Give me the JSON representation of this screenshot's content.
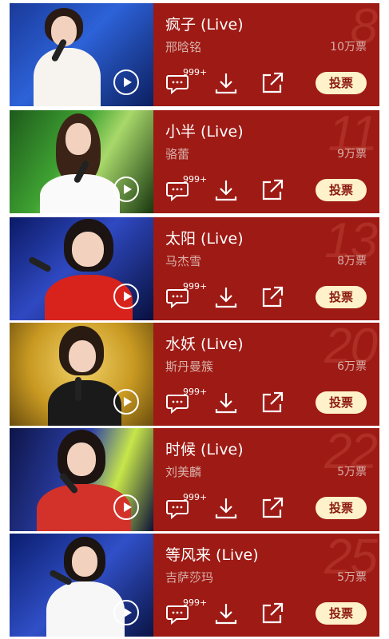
{
  "songs": [
    {
      "title": "疯子 (Live)",
      "artist": "邢晗铭",
      "votes": "10万票",
      "rank": "8",
      "comment_badge": "999+",
      "vote_label": "投票"
    },
    {
      "title": "小半 (Live)",
      "artist": "骆蕾",
      "votes": "9万票",
      "rank": "11",
      "comment_badge": "999+",
      "vote_label": "投票"
    },
    {
      "title": "太阳 (Live)",
      "artist": "马杰雪",
      "votes": "8万票",
      "rank": "13",
      "comment_badge": "999+",
      "vote_label": "投票"
    },
    {
      "title": "水妖 (Live)",
      "artist": "斯丹曼簇",
      "votes": "6万票",
      "rank": "20",
      "comment_badge": "999+",
      "vote_label": "投票"
    },
    {
      "title": "时候 (Live)",
      "artist": "刘美麟",
      "votes": "5万票",
      "rank": "22",
      "comment_badge": "999+",
      "vote_label": "投票"
    },
    {
      "title": "等风来 (Live)",
      "artist": "吉萨莎玛",
      "votes": "5万票",
      "rank": "25",
      "comment_badge": "999+",
      "vote_label": "投票"
    }
  ],
  "colors": {
    "card_bg": "#9e1a14",
    "vote_button": "#fff1c9",
    "vote_text": "#8c1a10"
  },
  "icons": [
    "play-icon",
    "comment-icon",
    "download-icon",
    "share-icon"
  ]
}
